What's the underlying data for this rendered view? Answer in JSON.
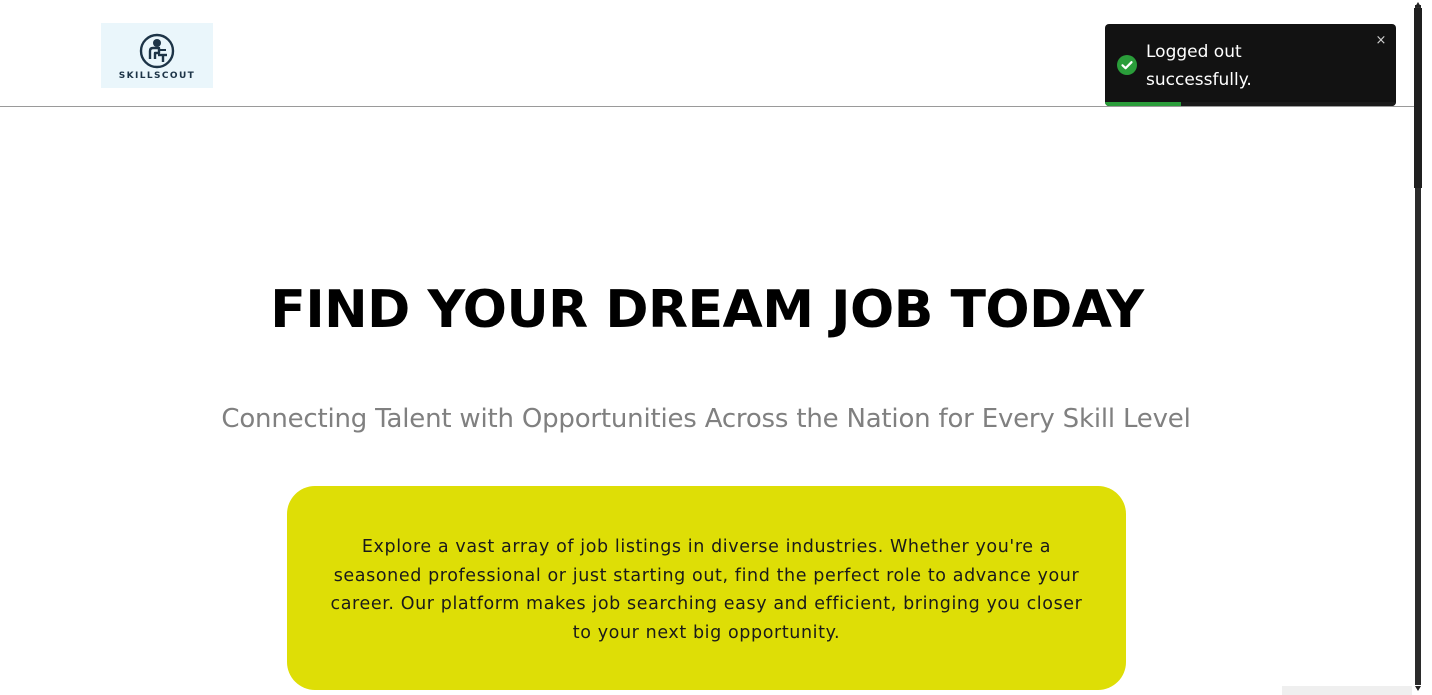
{
  "header": {
    "logo": {
      "text": "SKILLSCOUT",
      "icon": "person-at-desk-logo-icon",
      "background": "#eaf6fb"
    }
  },
  "toast": {
    "message": "Logged out successfully.",
    "status": "success",
    "icon": "check-circle-icon",
    "close_icon": "close-icon",
    "close_label": "×",
    "progress": 0.26,
    "accent_color": "#2a9d3a",
    "background": "#121212"
  },
  "hero": {
    "title": "FIND YOUR DREAM JOB TODAY",
    "subtitle": "Connecting Talent with Opportunities Across the Nation for Every Skill Level"
  },
  "promo": {
    "text": "Explore a vast array of job listings in diverse industries. Whether you're a seasoned professional or just starting out, find the perfect role to advance your career. Our platform makes job searching easy and efficient, bringing you closer to your next big opportunity.",
    "background": "#dede06"
  }
}
